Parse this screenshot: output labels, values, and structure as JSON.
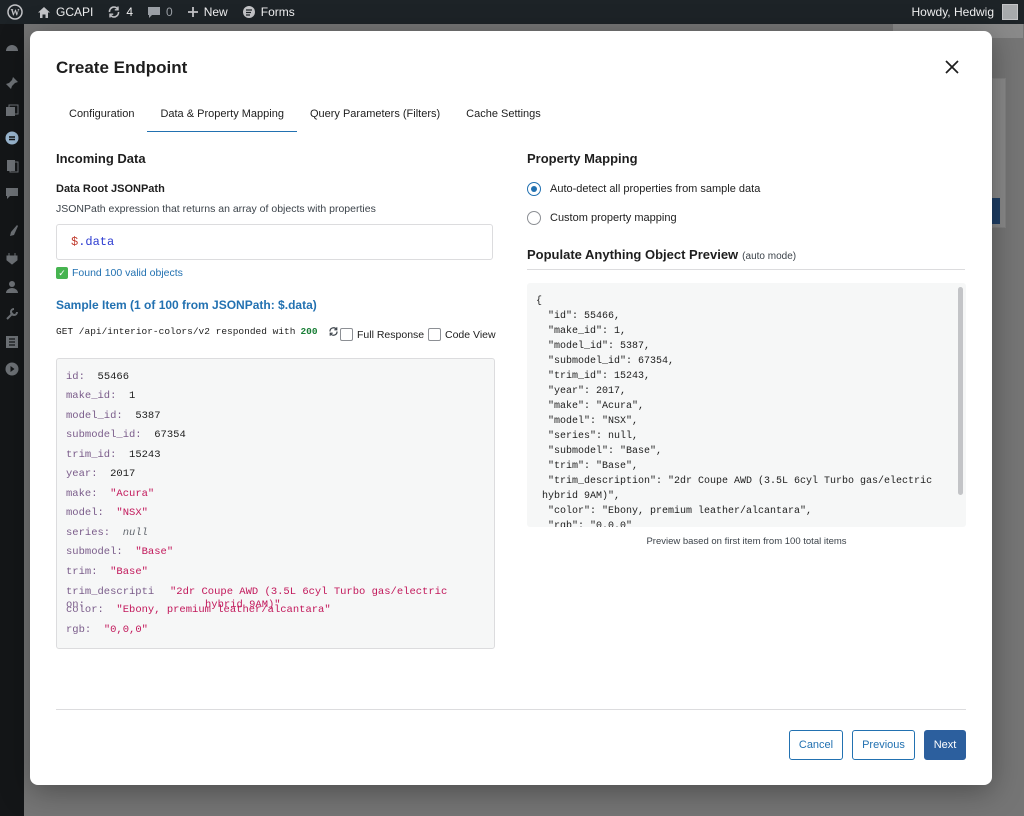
{
  "adminbar": {
    "site_name": "GCAPI",
    "updates_count": "4",
    "comments_count": "0",
    "new_label": "New",
    "forms_label": "Forms",
    "greeting": "Howdy, Hedwig"
  },
  "modal": {
    "title": "Create Endpoint",
    "tabs": [
      {
        "label": "Configuration",
        "active": false
      },
      {
        "label": "Data & Property Mapping",
        "active": true
      },
      {
        "label": "Query Parameters (Filters)",
        "active": false
      },
      {
        "label": "Cache Settings",
        "active": false
      }
    ]
  },
  "incoming": {
    "heading": "Incoming Data",
    "root_label": "Data Root JSONPath",
    "root_help": "JSONPath expression that returns an array of objects with properties",
    "root_value_dollar": "$",
    "root_value_rest": ".data",
    "found_text": "Found 100 valid objects",
    "sample_title": "Sample Item (1 of 100 from JSONPath: $.data)",
    "get_text": "GET /api/interior-colors/v2 responded with",
    "get_status": "200",
    "full_response_label": "Full Response",
    "code_view_label": "Code View",
    "sample_fields": [
      {
        "key": "id:",
        "value": "55466",
        "type": "num"
      },
      {
        "key": "make_id:",
        "value": "1",
        "type": "num"
      },
      {
        "key": "model_id:",
        "value": "5387",
        "type": "num"
      },
      {
        "key": "submodel_id:",
        "value": "67354",
        "type": "num"
      },
      {
        "key": "trim_id:",
        "value": "15243",
        "type": "num"
      },
      {
        "key": "year:",
        "value": "2017",
        "type": "num"
      },
      {
        "key": "make:",
        "value": "\"Acura\"",
        "type": "str"
      },
      {
        "key": "model:",
        "value": "\"NSX\"",
        "type": "str"
      },
      {
        "key": "series:",
        "value": "null",
        "type": "null"
      },
      {
        "key": "submodel:",
        "value": "\"Base\"",
        "type": "str"
      },
      {
        "key": "trim:",
        "value": "\"Base\"",
        "type": "str"
      },
      {
        "key": "trim_descripti",
        "value": "\"2dr Coupe AWD (3.5L 6cyl Turbo gas/electric",
        "type": "str"
      },
      {
        "key": "color:",
        "value": "\"Ebony, premium leather/alcantara\"",
        "type": "str"
      },
      {
        "key": "rgb:",
        "value": "\"0,0,0\"",
        "type": "str"
      }
    ],
    "trim_desc_overflow_key": "on:",
    "trim_desc_overflow_value": "hybrid 9AM)\""
  },
  "mapping": {
    "heading": "Property Mapping",
    "options": [
      {
        "label": "Auto-detect all properties from sample data",
        "selected": true
      },
      {
        "label": "Custom property mapping",
        "selected": false
      }
    ],
    "preview_heading": "Populate Anything Object Preview",
    "preview_mode": "(auto mode)",
    "preview_json": "{\n  \"id\": 55466,\n  \"make_id\": 1,\n  \"model_id\": 5387,\n  \"submodel_id\": 67354,\n  \"trim_id\": 15243,\n  \"year\": 2017,\n  \"make\": \"Acura\",\n  \"model\": \"NSX\",\n  \"series\": null,\n  \"submodel\": \"Base\",\n  \"trim\": \"Base\",\n  \"trim_description\": \"2dr Coupe AWD (3.5L 6cyl Turbo gas/electric\n hybrid 9AM)\",\n  \"color\": \"Ebony, premium leather/alcantara\",\n  \"rgb\": \"0.0.0\"",
    "preview_note": "Preview based on first item from 100 total items"
  },
  "footer": {
    "cancel_label": "Cancel",
    "previous_label": "Previous",
    "next_label": "Next"
  },
  "colors": {
    "accent": "#2271b1",
    "primary_button": "#2c5f9e",
    "adminbar": "#1d2327"
  }
}
